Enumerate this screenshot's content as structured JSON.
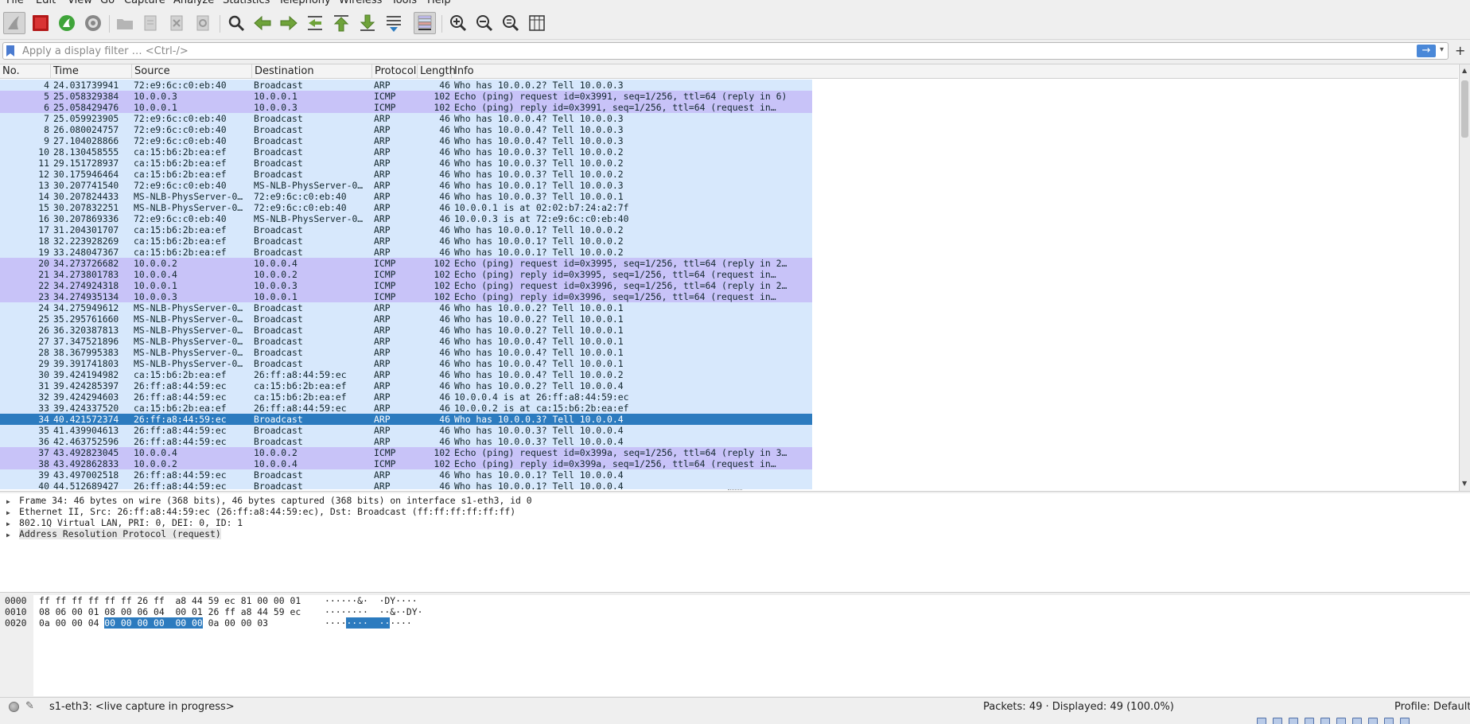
{
  "menu": [
    "File",
    "Edit",
    "View",
    "Go",
    "Capture",
    "Analyze",
    "Statistics",
    "Telephony",
    "Wireless",
    "Tools",
    "Help"
  ],
  "filter": {
    "placeholder": "Apply a display filter … <Ctrl-/>",
    "apply_glyph": "→",
    "dropdown_glyph": "▾",
    "add_glyph": "+"
  },
  "columns": {
    "no": "No.",
    "time": "Time",
    "source": "Source",
    "destination": "Destination",
    "protocol": "Protocol",
    "length": "Length",
    "info": "Info"
  },
  "packets": [
    {
      "no": "4",
      "time": "24.031739941",
      "src": "72:e9:6c:c0:eb:40",
      "dst": "Broadcast",
      "proto": "ARP",
      "len": "46",
      "info": "Who has 10.0.0.2? Tell 10.0.0.3"
    },
    {
      "no": "5",
      "time": "25.058329384",
      "src": "10.0.0.3",
      "dst": "10.0.0.1",
      "proto": "ICMP",
      "len": "102",
      "info": "Echo (ping) request  id=0x3991, seq=1/256, ttl=64 (reply in 6)"
    },
    {
      "no": "6",
      "time": "25.058429476",
      "src": "10.0.0.1",
      "dst": "10.0.0.3",
      "proto": "ICMP",
      "len": "102",
      "info": "Echo (ping) reply    id=0x3991, seq=1/256, ttl=64 (request in…"
    },
    {
      "no": "7",
      "time": "25.059923905",
      "src": "72:e9:6c:c0:eb:40",
      "dst": "Broadcast",
      "proto": "ARP",
      "len": "46",
      "info": "Who has 10.0.0.4? Tell 10.0.0.3"
    },
    {
      "no": "8",
      "time": "26.080024757",
      "src": "72:e9:6c:c0:eb:40",
      "dst": "Broadcast",
      "proto": "ARP",
      "len": "46",
      "info": "Who has 10.0.0.4? Tell 10.0.0.3"
    },
    {
      "no": "9",
      "time": "27.104028866",
      "src": "72:e9:6c:c0:eb:40",
      "dst": "Broadcast",
      "proto": "ARP",
      "len": "46",
      "info": "Who has 10.0.0.4? Tell 10.0.0.3"
    },
    {
      "no": "10",
      "time": "28.130458555",
      "src": "ca:15:b6:2b:ea:ef",
      "dst": "Broadcast",
      "proto": "ARP",
      "len": "46",
      "info": "Who has 10.0.0.3? Tell 10.0.0.2"
    },
    {
      "no": "11",
      "time": "29.151728937",
      "src": "ca:15:b6:2b:ea:ef",
      "dst": "Broadcast",
      "proto": "ARP",
      "len": "46",
      "info": "Who has 10.0.0.3? Tell 10.0.0.2"
    },
    {
      "no": "12",
      "time": "30.175946464",
      "src": "ca:15:b6:2b:ea:ef",
      "dst": "Broadcast",
      "proto": "ARP",
      "len": "46",
      "info": "Who has 10.0.0.3? Tell 10.0.0.2"
    },
    {
      "no": "13",
      "time": "30.207741540",
      "src": "72:e9:6c:c0:eb:40",
      "dst": "MS-NLB-PhysServer-0…",
      "proto": "ARP",
      "len": "46",
      "info": "Who has 10.0.0.1? Tell 10.0.0.3"
    },
    {
      "no": "14",
      "time": "30.207824433",
      "src": "MS-NLB-PhysServer-0…",
      "dst": "72:e9:6c:c0:eb:40",
      "proto": "ARP",
      "len": "46",
      "info": "Who has 10.0.0.3? Tell 10.0.0.1"
    },
    {
      "no": "15",
      "time": "30.207832251",
      "src": "MS-NLB-PhysServer-0…",
      "dst": "72:e9:6c:c0:eb:40",
      "proto": "ARP",
      "len": "46",
      "info": "10.0.0.1 is at 02:02:b7:24:a2:7f"
    },
    {
      "no": "16",
      "time": "30.207869336",
      "src": "72:e9:6c:c0:eb:40",
      "dst": "MS-NLB-PhysServer-0…",
      "proto": "ARP",
      "len": "46",
      "info": "10.0.0.3 is at 72:e9:6c:c0:eb:40"
    },
    {
      "no": "17",
      "time": "31.204301707",
      "src": "ca:15:b6:2b:ea:ef",
      "dst": "Broadcast",
      "proto": "ARP",
      "len": "46",
      "info": "Who has 10.0.0.1? Tell 10.0.0.2"
    },
    {
      "no": "18",
      "time": "32.223928269",
      "src": "ca:15:b6:2b:ea:ef",
      "dst": "Broadcast",
      "proto": "ARP",
      "len": "46",
      "info": "Who has 10.0.0.1? Tell 10.0.0.2"
    },
    {
      "no": "19",
      "time": "33.248047367",
      "src": "ca:15:b6:2b:ea:ef",
      "dst": "Broadcast",
      "proto": "ARP",
      "len": "46",
      "info": "Who has 10.0.0.1? Tell 10.0.0.2"
    },
    {
      "no": "20",
      "time": "34.273726682",
      "src": "10.0.0.2",
      "dst": "10.0.0.4",
      "proto": "ICMP",
      "len": "102",
      "info": "Echo (ping) request  id=0x3995, seq=1/256, ttl=64 (reply in 2…"
    },
    {
      "no": "21",
      "time": "34.273801783",
      "src": "10.0.0.4",
      "dst": "10.0.0.2",
      "proto": "ICMP",
      "len": "102",
      "info": "Echo (ping) reply    id=0x3995, seq=1/256, ttl=64 (request in…"
    },
    {
      "no": "22",
      "time": "34.274924318",
      "src": "10.0.0.1",
      "dst": "10.0.0.3",
      "proto": "ICMP",
      "len": "102",
      "info": "Echo (ping) request  id=0x3996, seq=1/256, ttl=64 (reply in 2…"
    },
    {
      "no": "23",
      "time": "34.274935134",
      "src": "10.0.0.3",
      "dst": "10.0.0.1",
      "proto": "ICMP",
      "len": "102",
      "info": "Echo (ping) reply    id=0x3996, seq=1/256, ttl=64 (request in…"
    },
    {
      "no": "24",
      "time": "34.275949612",
      "src": "MS-NLB-PhysServer-0…",
      "dst": "Broadcast",
      "proto": "ARP",
      "len": "46",
      "info": "Who has 10.0.0.2? Tell 10.0.0.1"
    },
    {
      "no": "25",
      "time": "35.295761660",
      "src": "MS-NLB-PhysServer-0…",
      "dst": "Broadcast",
      "proto": "ARP",
      "len": "46",
      "info": "Who has 10.0.0.2? Tell 10.0.0.1"
    },
    {
      "no": "26",
      "time": "36.320387813",
      "src": "MS-NLB-PhysServer-0…",
      "dst": "Broadcast",
      "proto": "ARP",
      "len": "46",
      "info": "Who has 10.0.0.2? Tell 10.0.0.1"
    },
    {
      "no": "27",
      "time": "37.347521896",
      "src": "MS-NLB-PhysServer-0…",
      "dst": "Broadcast",
      "proto": "ARP",
      "len": "46",
      "info": "Who has 10.0.0.4? Tell 10.0.0.1"
    },
    {
      "no": "28",
      "time": "38.367995383",
      "src": "MS-NLB-PhysServer-0…",
      "dst": "Broadcast",
      "proto": "ARP",
      "len": "46",
      "info": "Who has 10.0.0.4? Tell 10.0.0.1"
    },
    {
      "no": "29",
      "time": "39.391741803",
      "src": "MS-NLB-PhysServer-0…",
      "dst": "Broadcast",
      "proto": "ARP",
      "len": "46",
      "info": "Who has 10.0.0.4? Tell 10.0.0.1"
    },
    {
      "no": "30",
      "time": "39.424194982",
      "src": "ca:15:b6:2b:ea:ef",
      "dst": "26:ff:a8:44:59:ec",
      "proto": "ARP",
      "len": "46",
      "info": "Who has 10.0.0.4? Tell 10.0.0.2"
    },
    {
      "no": "31",
      "time": "39.424285397",
      "src": "26:ff:a8:44:59:ec",
      "dst": "ca:15:b6:2b:ea:ef",
      "proto": "ARP",
      "len": "46",
      "info": "Who has 10.0.0.2? Tell 10.0.0.4"
    },
    {
      "no": "32",
      "time": "39.424294603",
      "src": "26:ff:a8:44:59:ec",
      "dst": "ca:15:b6:2b:ea:ef",
      "proto": "ARP",
      "len": "46",
      "info": "10.0.0.4 is at 26:ff:a8:44:59:ec"
    },
    {
      "no": "33",
      "time": "39.424337520",
      "src": "ca:15:b6:2b:ea:ef",
      "dst": "26:ff:a8:44:59:ec",
      "proto": "ARP",
      "len": "46",
      "info": "10.0.0.2 is at ca:15:b6:2b:ea:ef"
    },
    {
      "no": "34",
      "time": "40.421572374",
      "src": "26:ff:a8:44:59:ec",
      "dst": "Broadcast",
      "proto": "ARP",
      "len": "46",
      "info": "Who has 10.0.0.3? Tell 10.0.0.4"
    },
    {
      "no": "35",
      "time": "41.439904613",
      "src": "26:ff:a8:44:59:ec",
      "dst": "Broadcast",
      "proto": "ARP",
      "len": "46",
      "info": "Who has 10.0.0.3? Tell 10.0.0.4"
    },
    {
      "no": "36",
      "time": "42.463752596",
      "src": "26:ff:a8:44:59:ec",
      "dst": "Broadcast",
      "proto": "ARP",
      "len": "46",
      "info": "Who has 10.0.0.3? Tell 10.0.0.4"
    },
    {
      "no": "37",
      "time": "43.492823045",
      "src": "10.0.0.4",
      "dst": "10.0.0.2",
      "proto": "ICMP",
      "len": "102",
      "info": "Echo (ping) request  id=0x399a, seq=1/256, ttl=64 (reply in 3…"
    },
    {
      "no": "38",
      "time": "43.492862833",
      "src": "10.0.0.2",
      "dst": "10.0.0.4",
      "proto": "ICMP",
      "len": "102",
      "info": "Echo (ping) reply    id=0x399a, seq=1/256, ttl=64 (request in…"
    },
    {
      "no": "39",
      "time": "43.497002518",
      "src": "26:ff:a8:44:59:ec",
      "dst": "Broadcast",
      "proto": "ARP",
      "len": "46",
      "info": "Who has 10.0.0.1? Tell 10.0.0.4"
    },
    {
      "no": "40",
      "time": "44.512689427",
      "src": "26:ff:a8:44:59:ec",
      "dst": "Broadcast",
      "proto": "ARP",
      "len": "46",
      "info": "Who has 10.0.0.1? Tell 10.0.0.4"
    }
  ],
  "selected_packet": "34",
  "details": [
    "Frame 34: 46 bytes on wire (368 bits), 46 bytes captured (368 bits) on interface s1-eth3, id 0",
    "Ethernet II, Src: 26:ff:a8:44:59:ec (26:ff:a8:44:59:ec), Dst: Broadcast (ff:ff:ff:ff:ff:ff)",
    "802.1Q Virtual LAN, PRI: 0, DEI: 0, ID: 1",
    "Address Resolution Protocol (request)"
  ],
  "bytes": [
    {
      "offset": "0000",
      "hex_pre": "ff ff ff ff ff ff 26 ff  a8 44 59 ec 81 00 00 01",
      "hex_sel": "",
      "hex_post": "",
      "ascii_pre": "······&·  ·DY····",
      "ascii_sel": "",
      "ascii_post": ""
    },
    {
      "offset": "0010",
      "hex_pre": "08 06 00 01 08 00 06 04  00 01 26 ff a8 44 59 ec",
      "hex_sel": "",
      "hex_post": "",
      "ascii_pre": "········  ··&··DY·",
      "ascii_sel": "",
      "ascii_post": ""
    },
    {
      "offset": "0020",
      "hex_pre": "0a 00 00 04 ",
      "hex_sel": "00 00 00 00  00 00",
      "hex_post": " 0a 00 00 03",
      "ascii_pre": "····",
      "ascii_sel": "····  ··",
      "ascii_post": "····"
    }
  ],
  "status": {
    "capture": "s1-eth3: <live capture in progress>",
    "packets": "Packets: 49 · Displayed: 49 (100.0%)",
    "profile": "Profile: Default"
  },
  "colors": {
    "arp_row": "#d7e8fc",
    "icmp_row": "#c8c3f8",
    "selected_row": "#2c7bbf"
  }
}
